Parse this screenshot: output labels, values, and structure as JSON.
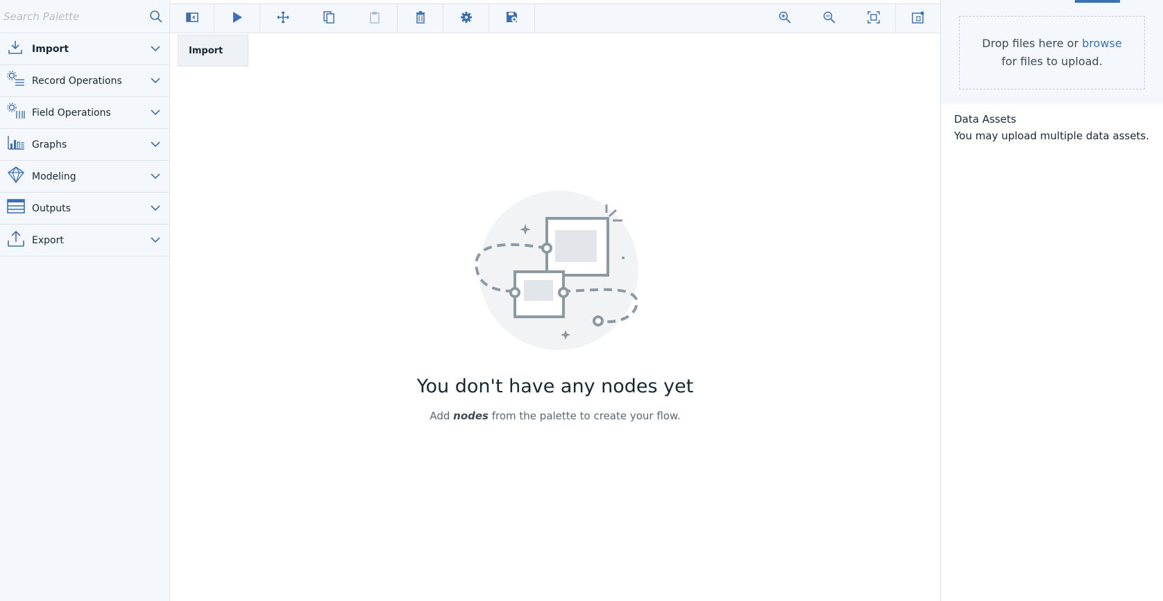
{
  "palette": {
    "search_placeholder": "Search Palette",
    "categories": [
      {
        "label": "Import",
        "icon": "import-icon",
        "active": true
      },
      {
        "label": "Record Operations",
        "icon": "record-operations-icon"
      },
      {
        "label": "Field Operations",
        "icon": "field-operations-icon"
      },
      {
        "label": "Graphs",
        "icon": "graphs-icon"
      },
      {
        "label": "Modeling",
        "icon": "modeling-icon"
      },
      {
        "label": "Outputs",
        "icon": "outputs-icon"
      },
      {
        "label": "Export",
        "icon": "export-icon"
      }
    ]
  },
  "toolbar": {
    "buttons": [
      "toggle-palette-icon",
      "run-icon",
      "move-icon",
      "copy-icon",
      "paste-icon",
      "delete-icon",
      "settings-icon",
      "save-icon",
      "zoom-in-icon",
      "zoom-out-icon",
      "fit-to-screen-icon",
      "toggle-right-panel-icon"
    ]
  },
  "tooltip": {
    "text": "Import"
  },
  "empty_state": {
    "title": "You don't have any nodes yet",
    "sub_prefix": "Add ",
    "sub_emphasis": "nodes",
    "sub_suffix": " from the palette to create your flow."
  },
  "right_panel": {
    "drop_text_1": "Drop files here or ",
    "drop_link": "browse",
    "drop_text_2": "for files to upload.",
    "assets_heading": "Data Assets",
    "assets_text": "You may upload multiple data assets."
  },
  "colors": {
    "accent": "#3d70b2",
    "background": "#f4f7fb",
    "text": "#152935"
  }
}
